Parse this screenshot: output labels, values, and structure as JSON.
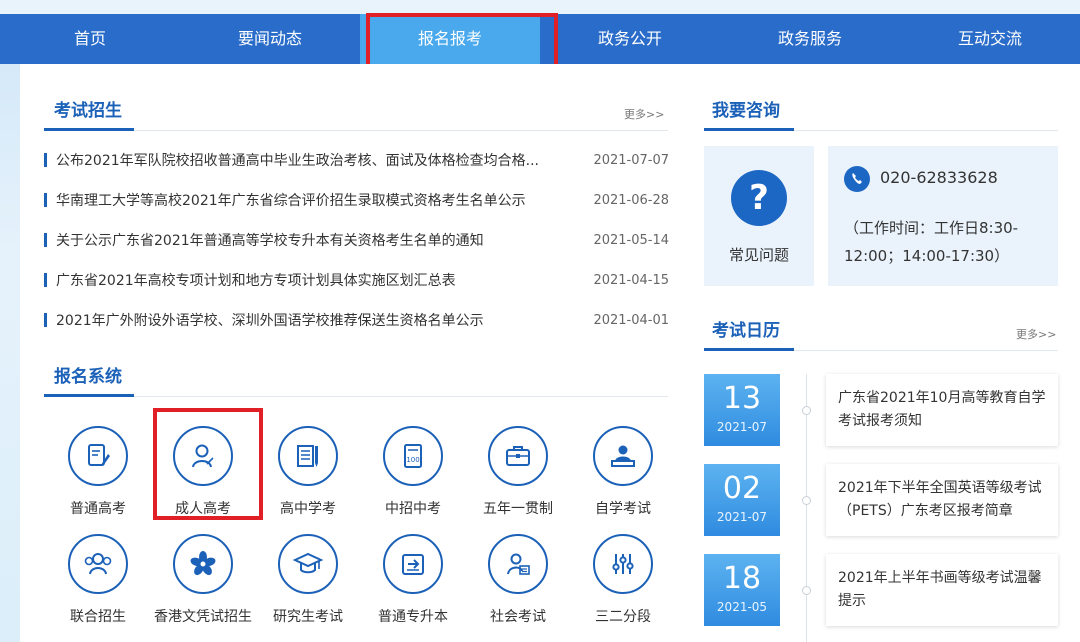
{
  "nav": {
    "items": [
      "首页",
      "要闻动态",
      "报名报考",
      "政务公开",
      "政务服务",
      "互动交流"
    ],
    "active_index": 2
  },
  "exam_admission": {
    "title": "考试招生",
    "more": "更多>>",
    "news": [
      {
        "title": "公布2021年军队院校招收普通高中毕业生政治考核、面试及体格检查均合格...",
        "date": "2021-07-07"
      },
      {
        "title": "华南理工大学等高校2021年广东省综合评价招生录取模式资格考生名单公示",
        "date": "2021-06-28"
      },
      {
        "title": "关于公示广东省2021年普通高等学校专升本有关资格考生名单的通知",
        "date": "2021-05-14"
      },
      {
        "title": "广东省2021年高校专项计划和地方专项计划具体实施区划汇总表",
        "date": "2021-04-15"
      },
      {
        "title": "2021年广外附设外语学校、深圳外国语学校推荐保送生资格名单公示",
        "date": "2021-04-01"
      }
    ]
  },
  "registration_system": {
    "title": "报名系统",
    "items": [
      {
        "label": "普通高考",
        "icon": "exam-paper-pen-icon"
      },
      {
        "label": "成人高考",
        "icon": "adult-person-icon"
      },
      {
        "label": "高中学考",
        "icon": "document-pencil-icon"
      },
      {
        "label": "中招中考",
        "icon": "score-sheet-icon"
      },
      {
        "label": "五年一贯制",
        "icon": "briefcase-icon"
      },
      {
        "label": "自学考试",
        "icon": "person-laptop-icon"
      },
      {
        "label": "联合招生",
        "icon": "group-people-icon"
      },
      {
        "label": "香港文凭试招生",
        "icon": "bauhinia-flower-icon"
      },
      {
        "label": "研究生考试",
        "icon": "graduation-cap-icon"
      },
      {
        "label": "普通专升本",
        "icon": "upgrade-arrow-icon"
      },
      {
        "label": "社会考试",
        "icon": "person-card-icon"
      },
      {
        "label": "三二分段",
        "icon": "sliders-icon"
      }
    ]
  },
  "consult": {
    "title": "我要咨询",
    "faq_label": "常见问题",
    "faq_icon": "question-icon",
    "phone": "020-62833628",
    "phone_icon": "phone-icon",
    "hours_line1": "（工作时间：工作日8:30-",
    "hours_line2": "12:00；14:00-17:30）"
  },
  "exam_calendar": {
    "title": "考试日历",
    "more": "更多>>",
    "events": [
      {
        "day": "13",
        "month": "2021-07",
        "text": "广东省2021年10月高等教育自学考试报考须知"
      },
      {
        "day": "02",
        "month": "2021-07",
        "text": "2021年下半年全国英语等级考试（PETS）广东考区报考简章"
      },
      {
        "day": "18",
        "month": "2021-05",
        "text": "2021年上半年书画等级考试温馨提示"
      }
    ]
  },
  "colors": {
    "nav_bg": "#2a6cc9",
    "nav_active": "#4aa9ec",
    "accent": "#1c61b8",
    "highlight_box": "#e01f26"
  }
}
